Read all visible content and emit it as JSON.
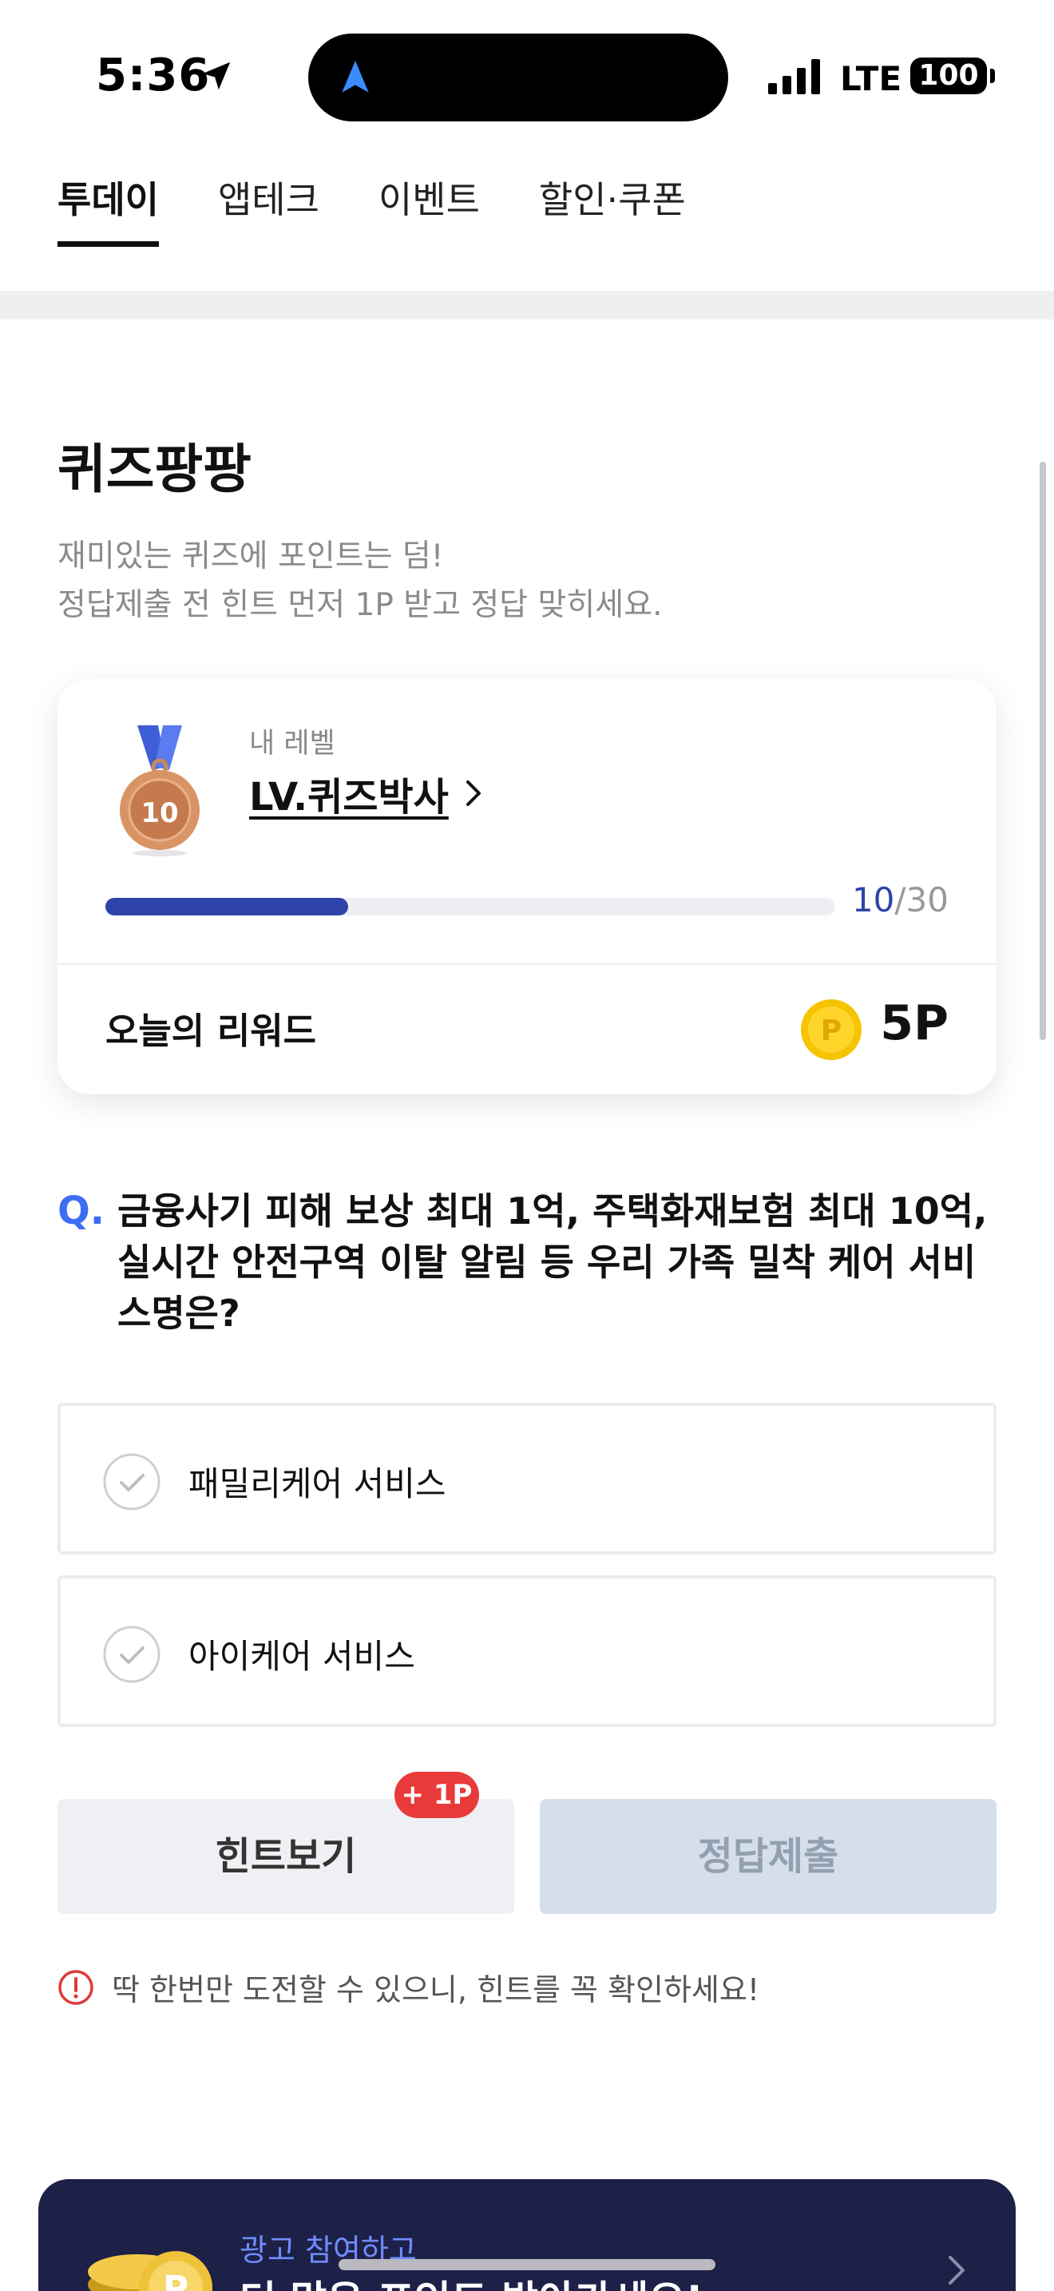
{
  "status_bar": {
    "time": "5:36",
    "network": "LTE",
    "battery": "100"
  },
  "tabs": [
    {
      "label": "투데이",
      "active": true
    },
    {
      "label": "앱테크",
      "active": false
    },
    {
      "label": "이벤트",
      "active": false
    },
    {
      "label": "할인·쿠폰",
      "active": false
    }
  ],
  "quiz": {
    "title": "퀴즈팡팡",
    "subtitle_line1": "재미있는 퀴즈에 포인트는 덤!",
    "subtitle_line2": "정답제출 전 힌트 먼저 1P 받고 정답 맞히세요."
  },
  "level_card": {
    "medal_number": "10",
    "level_label": "내 레벨",
    "level_name": "LV.퀴즈박사",
    "progress_current": "10",
    "progress_total": "/30",
    "progress_fraction": 0.333,
    "reward_label": "오늘의 리워드",
    "coin_symbol": "P",
    "reward_value": "5P"
  },
  "question": {
    "mark": "Q.",
    "text": "금융사기 피해 보상 최대 1억, 주택화재보험 최대 10억, 실시간 안전구역 이탈 알림 등 우리 가족 밀착 케어 서비스명은?"
  },
  "options": [
    {
      "label": "패밀리케어 서비스"
    },
    {
      "label": "아이케어 서비스"
    }
  ],
  "buttons": {
    "hint": "힌트보기",
    "hint_badge": "+ 1P",
    "submit": "정답제출"
  },
  "warning": "딱 한번만 도전할 수 있으니, 힌트를 꼭 확인하세요!",
  "ad_banner": {
    "line1": "광고 참여하고",
    "line2": "더 많은 포인트 받아가세요!"
  },
  "colors": {
    "accent": "#2f44a8",
    "question_mark": "#3d6df2",
    "badge": "#e83a3a",
    "banner_bg": "#1d2047"
  }
}
